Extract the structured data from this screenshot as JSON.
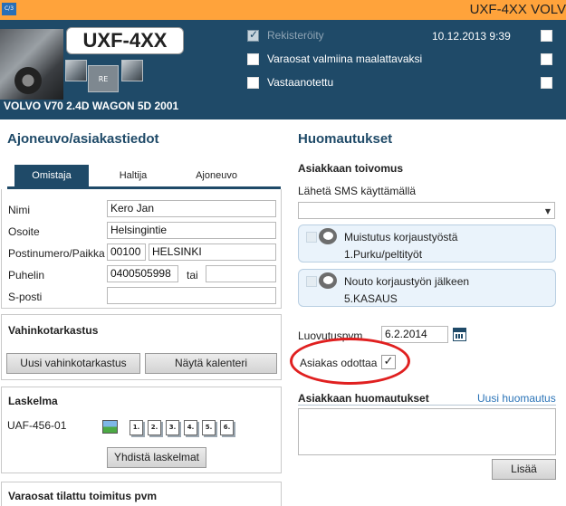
{
  "window": {
    "app_icon_label": "C/3",
    "title": "UXF-4XX VOLV"
  },
  "vehicle": {
    "plate": "UXF-4XX",
    "re_label": "RE",
    "model": "VOLVO V70 2.4D WAGON 5D 2001",
    "registered_label": "Rekisteröity",
    "parts_ready_label": "Varaosat valmiina maalattavaksi",
    "received_label": "Vastaanotettu",
    "datetime": "10.12.2013 9:39"
  },
  "left": {
    "section_title": "Ajoneuvo/asiakastiedot",
    "tabs": [
      {
        "label": "Omistaja",
        "active": true
      },
      {
        "label": "Haltija",
        "active": false
      },
      {
        "label": "Ajoneuvo",
        "active": false
      }
    ],
    "form": {
      "name_label": "Nimi",
      "name_value": "Kero Jan",
      "address_label": "Osoite",
      "address_value": "Helsingintie",
      "postal_label": "Postinumero/Paikka",
      "postal_code": "00100",
      "city": "HELSINKI",
      "phone_label": "Puhelin",
      "phone_value": "0400505998",
      "phone_or_label": "tai",
      "phone2_value": "",
      "email_label": "S-posti",
      "email_value": ""
    },
    "damage": {
      "title": "Vahinkotarkastus",
      "new_button": "Uusi vahinkotarkastus",
      "calendar_button": "Näytä kalenteri"
    },
    "calculation": {
      "title": "Laskelma",
      "id": "UAF-456-01",
      "docs": [
        "1.",
        "2.",
        "3.",
        "4.",
        "5.",
        "6."
      ],
      "merge_button": "Yhdistä laskelmat"
    },
    "parts_ordered_title": "Varaosat tilattu toimitus pvm"
  },
  "right": {
    "section_title": "Huomautukset",
    "customer_wish_title": "Asiakkaan toivomus",
    "sms_label": "Lähetä SMS käyttämällä",
    "sms_select_value": "",
    "notes": [
      {
        "title": "Muistutus korjaustyöstä",
        "sub": "1.Purku/peltityöt"
      },
      {
        "title": "Nouto korjaustyön jälkeen",
        "sub": "5.KASAUS"
      }
    ],
    "delivery_label": "Luovutuspvm",
    "delivery_date": "6.2.2014",
    "waiting_label": "Asiakas odottaa",
    "waiting_checked": true,
    "remarks_title": "Asiakkaan huomautukset",
    "new_remark_link": "Uusi huomautus",
    "remarks_text": "",
    "add_button": "Lisää"
  },
  "colors": {
    "title_bar": "#ffa33b",
    "header_bg": "#1f4a68",
    "accent": "#1f4a68",
    "link": "#2b74b8",
    "annotation_circle": "#e02020"
  }
}
